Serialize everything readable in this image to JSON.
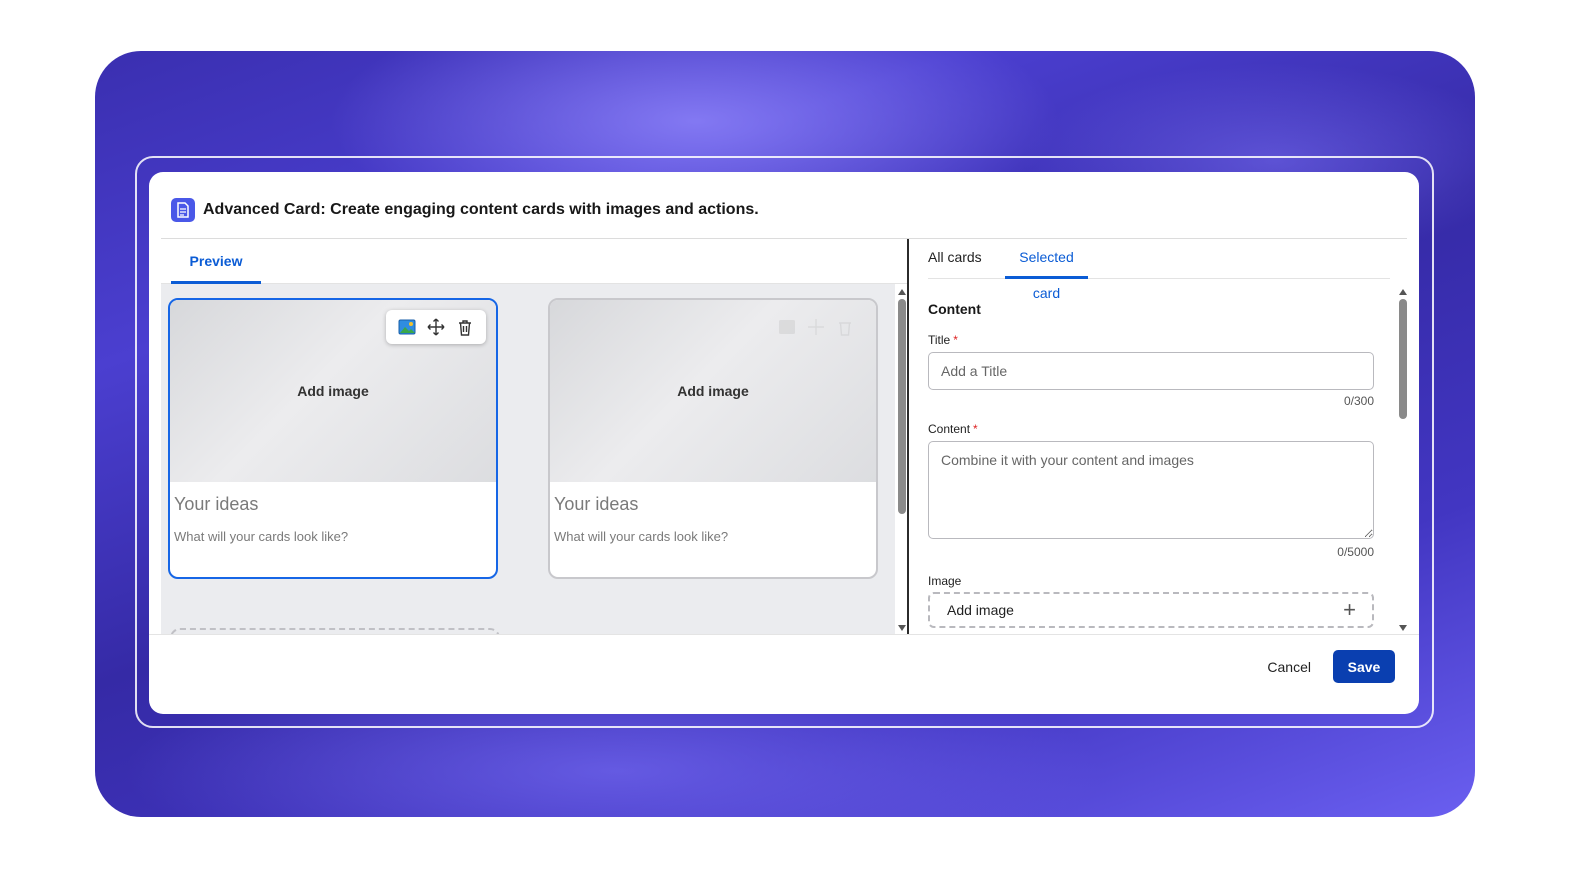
{
  "dialog": {
    "title": "Advanced Card: Create engaging content cards with images and actions."
  },
  "left": {
    "tab_preview": "Preview",
    "cards": [
      {
        "image_label": "Add image",
        "title": "Your ideas",
        "description": "What will your cards look like?"
      },
      {
        "image_label": "Add image",
        "title": "Your ideas",
        "description": "What will your cards look like?"
      }
    ]
  },
  "right": {
    "tabs": {
      "all": "All cards",
      "selected": "Selected card"
    },
    "section_title": "Content",
    "title_field": {
      "label": "Title",
      "required_mark": "*",
      "placeholder": "Add a Title",
      "value": "",
      "counter": "0/300"
    },
    "content_field": {
      "label": "Content",
      "required_mark": "*",
      "placeholder": "Combine it with your content and images",
      "value": "",
      "counter": "0/5000"
    },
    "image_field": {
      "label": "Image",
      "button_label": "Add image",
      "plus": "+"
    }
  },
  "footer": {
    "cancel_label": "Cancel",
    "save_label": "Save"
  },
  "colors": {
    "accent": "#0b5cd5",
    "save_bg": "#0a3fb0",
    "selected_border": "#1666e6",
    "app_icon": "#4a58e8"
  },
  "icons": [
    "document-icon",
    "image-icon",
    "move-icon",
    "trash-icon",
    "plus-icon"
  ]
}
